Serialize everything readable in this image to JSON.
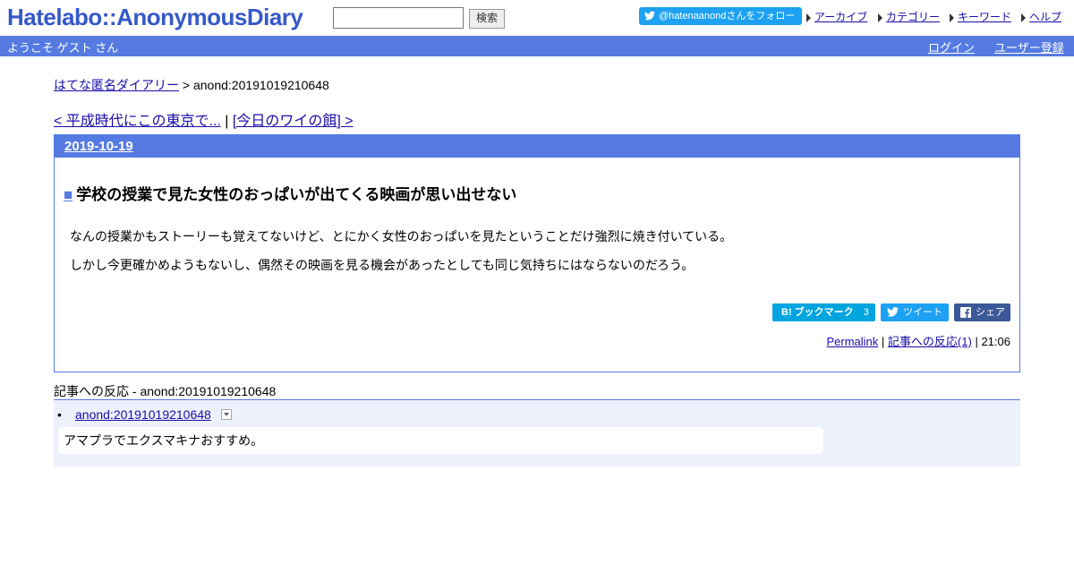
{
  "header": {
    "logo": "Hatelabo::AnonymousDiary",
    "search": {
      "value": "",
      "button": "検索"
    },
    "twitter_follow": "@hatenaanondさんをフォロー",
    "links": [
      "アーカイブ",
      "カテゴリー",
      "キーワード",
      "ヘルプ"
    ]
  },
  "userbar": {
    "welcome": "ようこそ ゲスト さん",
    "login": "ログイン",
    "register": "ユーザー登録"
  },
  "breadcrumb": {
    "home": "はてな匿名ダイアリー",
    "separator": ">",
    "current": "anond:20191019210648"
  },
  "nav": {
    "prev": "< 平成時代にこの東京で...",
    "separator": "|",
    "next": "[今日のワイの餌] >"
  },
  "article": {
    "date": "2019-10-19",
    "title_marker": "■",
    "title": "学校の授業で見た女性のおっぱいが出てくる映画が思い出せない",
    "paragraphs": [
      "なんの授業かもストーリーも覚えてないけど、とにかく女性のおっぱいを見たということだけ強烈に焼き付いている。",
      "しかし今更確かめようもないし、偶然その映画を見る機会があったとしても同じ気持ちにはならないのだろう。"
    ],
    "share": {
      "bookmark": "B! ブックマーク",
      "bookmark_count": "3",
      "tweet": "ツイート",
      "facebook": "シェア"
    },
    "permalink": "Permalink",
    "sep": "|",
    "reactions_link": "記事への反応(1)",
    "time": "21:06"
  },
  "reactions": {
    "heading": "記事への反応 - anond:20191019210648",
    "items": [
      {
        "link": "anond:20191019210648",
        "body": "アマプラでエクスマキナおすすめ。"
      }
    ]
  },
  "colors": {
    "accent": "#557be2",
    "link": "#1a0dab",
    "reaction_bg": "#edf1fb",
    "twitter": "#1da1f2",
    "hatena": "#00a4de",
    "facebook": "#3b5998"
  }
}
